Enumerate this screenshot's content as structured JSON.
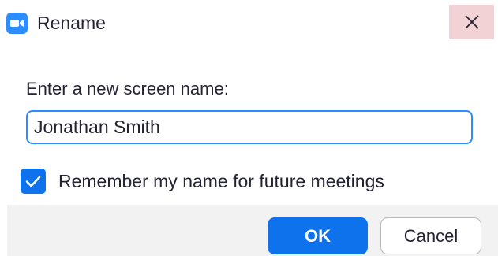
{
  "window": {
    "title": "Rename",
    "app_icon": "zoom-video-camera-icon",
    "close_icon": "close-icon"
  },
  "form": {
    "prompt": "Enter a new screen name:",
    "name_value": "Jonathan Smith",
    "remember_checked": true,
    "remember_label": "Remember my name for future meetings"
  },
  "buttons": {
    "ok_label": "OK",
    "cancel_label": "Cancel"
  },
  "colors": {
    "accent": "#0e72ed",
    "input_border": "#2d8cff",
    "close_hover": "#f3d2d6",
    "footer_bg": "#f2f2f2"
  }
}
